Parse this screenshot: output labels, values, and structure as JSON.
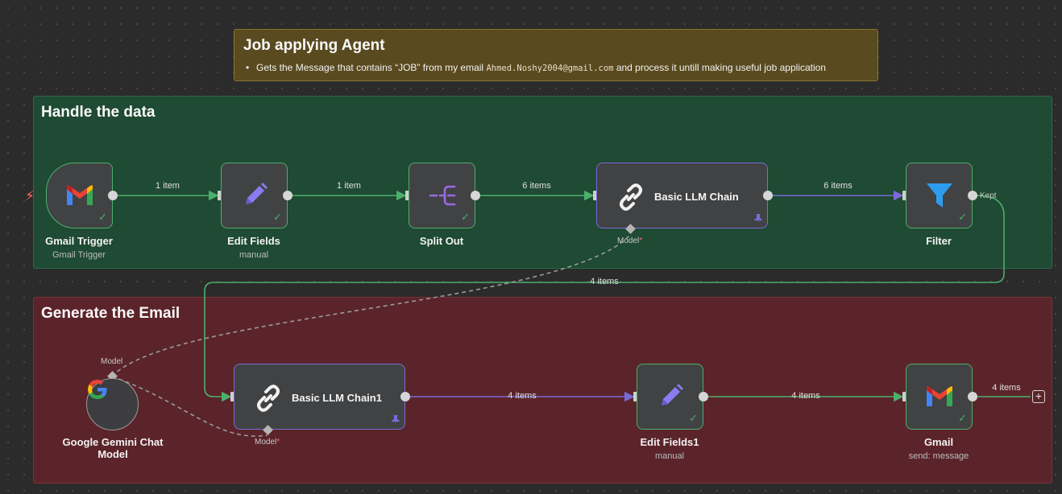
{
  "sticky_note": {
    "title": "Job applying Agent",
    "bullet_before": "Gets the Message that contains “JOB” from my email ",
    "bullet_email": "Ahmed.Noshy2004@gmail.com",
    "bullet_after": " and process it untill making useful job application"
  },
  "groups": {
    "handle": "Handle the data",
    "generate": "Generate the Email"
  },
  "nodes": {
    "gmail_trigger": {
      "title": "Gmail Trigger",
      "subtitle": "Gmail Trigger",
      "icon": "gmail-icon"
    },
    "edit_fields": {
      "title": "Edit Fields",
      "subtitle": "manual",
      "icon": "pencil-icon"
    },
    "split_out": {
      "title": "Split Out",
      "icon": "split-out-icon"
    },
    "llm_chain": {
      "label": "Basic LLM Chain",
      "port_label": "Model",
      "icon": "chain-link-icon"
    },
    "filter": {
      "title": "Filter",
      "output_label": "Kept",
      "icon": "filter-icon"
    },
    "gemini": {
      "title": "Google Gemini Chat",
      "title2": "Model",
      "port_label": "Model",
      "icon": "google-icon"
    },
    "llm_chain1": {
      "label": "Basic LLM Chain1",
      "port_label": "Model",
      "icon": "chain-link-icon"
    },
    "edit_fields1": {
      "title": "Edit Fields1",
      "subtitle": "manual",
      "icon": "pencil-icon"
    },
    "gmail": {
      "title": "Gmail",
      "subtitle": "send: message",
      "icon": "gmail-icon"
    }
  },
  "edges": {
    "e1": "1 item",
    "e2": "1 item",
    "e3": "6 items",
    "e4": "6 items",
    "e5": "4 items",
    "e6": "4 items",
    "e7": "4 items",
    "e8": "4 items"
  },
  "colors": {
    "success_edge": "#4caf6b",
    "ai_edge": "#7a6ad8",
    "trigger_bolt": "#ff6a5c"
  }
}
